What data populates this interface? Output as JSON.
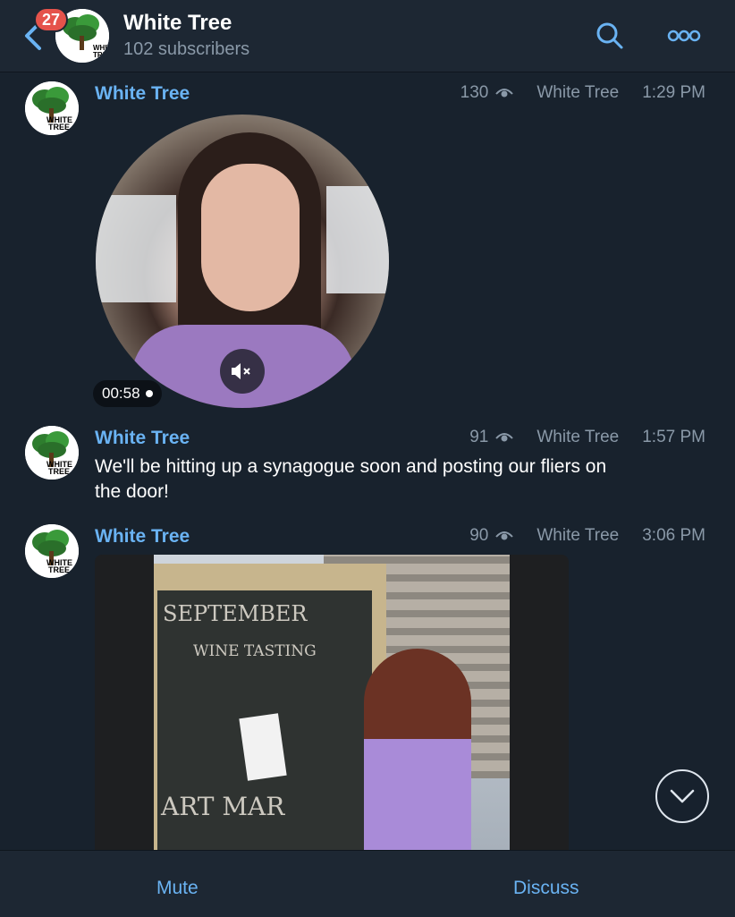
{
  "header": {
    "unread_badge": "27",
    "title": "White Tree",
    "subtitle": "102 subscribers",
    "logo_text": "WHITE TREE"
  },
  "messages": [
    {
      "author": "White Tree",
      "views": "130",
      "signature": "White Tree",
      "time": "1:29 PM",
      "media": "video-message",
      "duration": "00:58"
    },
    {
      "author": "White Tree",
      "views": "91",
      "signature": "White Tree",
      "time": "1:57 PM",
      "text": "We'll be hitting up a synagogue soon and posting our fliers on the door!"
    },
    {
      "author": "White Tree",
      "views": "90",
      "signature": "White Tree",
      "time": "3:06 PM",
      "media": "photo"
    }
  ],
  "photo_chalk": {
    "line1": "SEPTEMBER",
    "line2": "WINE TASTING",
    "line3": "ART MAR"
  },
  "bottom_bar": {
    "mute_label": "Mute",
    "discuss_label": "Discuss"
  },
  "colors": {
    "background": "#18222d",
    "header": "#1d2733",
    "accent": "#6ab3f3",
    "badge": "#e5534b",
    "muted_text": "#8a99a8"
  },
  "icons": [
    "back-chevron-icon",
    "search-icon",
    "more-icon",
    "eye-icon",
    "speaker-muted-icon",
    "chevron-down-icon"
  ]
}
